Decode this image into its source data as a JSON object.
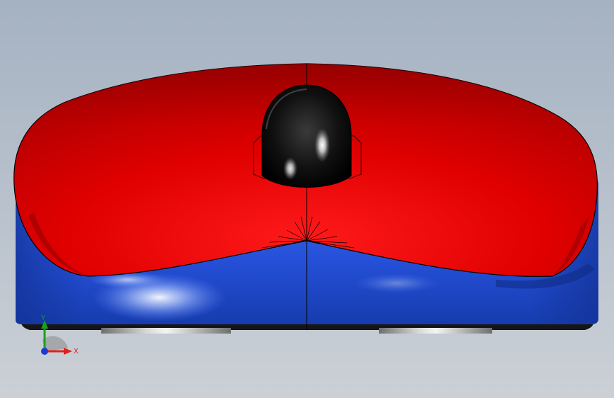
{
  "viewport": {
    "background_top": "#a8b4c4",
    "background_bottom": "#c9cfd6"
  },
  "model": {
    "top_shell_color": "#e60000",
    "base_color": "#2f5fe0",
    "scroll_wheel_color": "#0a0a0a",
    "edge_line_color": "#000000"
  },
  "triad": {
    "x_label": "X",
    "y_label": "Y",
    "x_color": "#e02020",
    "y_color": "#18a018",
    "z_color": "#1a3bd6"
  }
}
